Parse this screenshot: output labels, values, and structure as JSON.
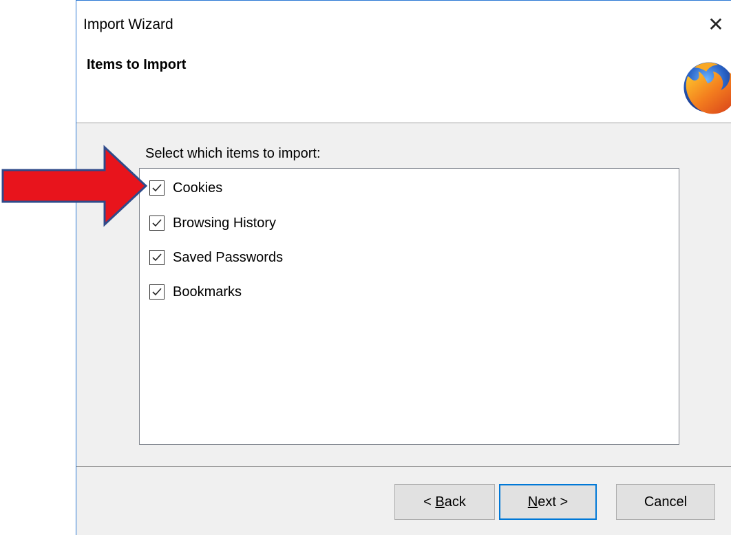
{
  "window": {
    "title": "Import Wizard",
    "close_glyph": "✕"
  },
  "header": {
    "title": "Items to Import",
    "logo_icon": "firefox-logo"
  },
  "content": {
    "prompt": "Select which items to import:",
    "items": [
      {
        "label": "Cookies",
        "checked": true
      },
      {
        "label": "Browsing History",
        "checked": true
      },
      {
        "label": "Saved Passwords",
        "checked": true
      },
      {
        "label": "Bookmarks",
        "checked": true
      }
    ]
  },
  "buttons": {
    "back": {
      "prefix": "< ",
      "mnemonic": "B",
      "rest": "ack"
    },
    "next": {
      "mnemonic": "N",
      "rest": "ext >"
    },
    "cancel": "Cancel"
  },
  "annotation": {
    "icon": "red-arrow-icon",
    "color": "#e8141c",
    "outline": "#2f4a8a"
  },
  "colors": {
    "accent": "#0078d7",
    "button_face": "#e1e1e1",
    "dialog_background": "#f0f0f0"
  }
}
